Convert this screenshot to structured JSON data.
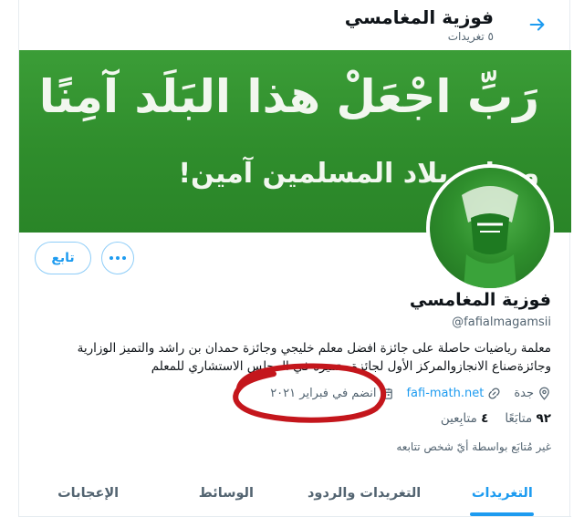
{
  "header": {
    "title": "فوزية المغامسي",
    "subtitle": "٥ تغريدات",
    "back_icon": "arrow-right-icon"
  },
  "banner": {
    "line1": "رَبِّ اجْعَلْ هذا البَلَد آمِنًا",
    "line2": "وسائر بلاد المسلمين آمين!"
  },
  "profile": {
    "name": "فوزية المغامسي",
    "handle": "@fafialmagamsii",
    "bio": "معلمة رياضيات حاصلة على جائزة  افضل معلم خليجي  وجائزة حمدان بن راشد والتميز الوزارية وجائزةصناع الانجازوالمركز الأول لجائزة متميزة في المجلس الاستشاري للمعلم",
    "location": "جدة",
    "website": "fafi-math.net",
    "joined": "انضم في فبراير ٢٠٢١",
    "following_count": "٩٢",
    "following_label": "متابَعًا",
    "followers_count": "٤",
    "followers_label": "متابِعين",
    "followers_note": "غير مُتابَع بواسطة أيّ شخص تتابعه"
  },
  "actions": {
    "follow_label": "تابع",
    "more_icon": "more-dots-icon"
  },
  "tabs": [
    {
      "label": "التغريدات",
      "active": true
    },
    {
      "label": "التغريدات والردود",
      "active": false
    },
    {
      "label": "الوسائط",
      "active": false
    },
    {
      "label": "الإعجابات",
      "active": false
    }
  ],
  "colors": {
    "accent": "#1d9bf0",
    "banner_green": "#2f8d2c",
    "annotation_red": "#c4161c"
  }
}
